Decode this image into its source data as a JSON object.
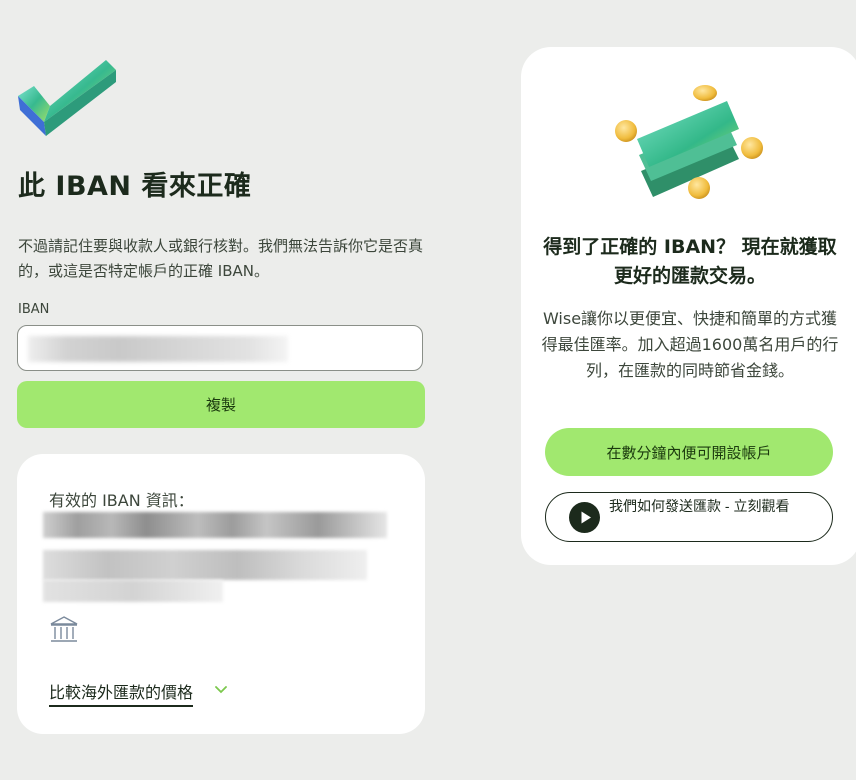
{
  "page": {
    "title": "此 IBAN 看來正確",
    "description": "不過請記住要與收款人或銀行核對。我們無法告訴你它是否真的，或這是否特定帳戶的正確 IBAN。"
  },
  "iban_field": {
    "label": "IBAN",
    "value": ""
  },
  "copy_button": {
    "label": "複製"
  },
  "info_card": {
    "title": "有效的 IBAN 資訊：",
    "compare_link": "比較海外匯款的價格"
  },
  "promo": {
    "title": "得到了正確的 IBAN？ 現在就獲取更好的匯款交易。",
    "body": "Wise讓你以更便宜、快捷和簡單的方式獲得最佳匯率。加入超過1600萬名用戶的行列，在匯款的同時節省金錢。",
    "open_account_button": "在數分鐘內便可開設帳戶",
    "video_button": "我們如何發送匯款 - 立刻觀看"
  },
  "icons": {
    "checkmark": "checkmark-illustration",
    "money": "money-illustration",
    "bank": "bank-icon",
    "chevron": "chevron-down-icon",
    "play": "play-icon"
  },
  "colors": {
    "page_background": "#ecedeb",
    "accent_green": "#a1e86f",
    "text_dark": "#1c2a1c",
    "card_background": "#ffffff"
  }
}
